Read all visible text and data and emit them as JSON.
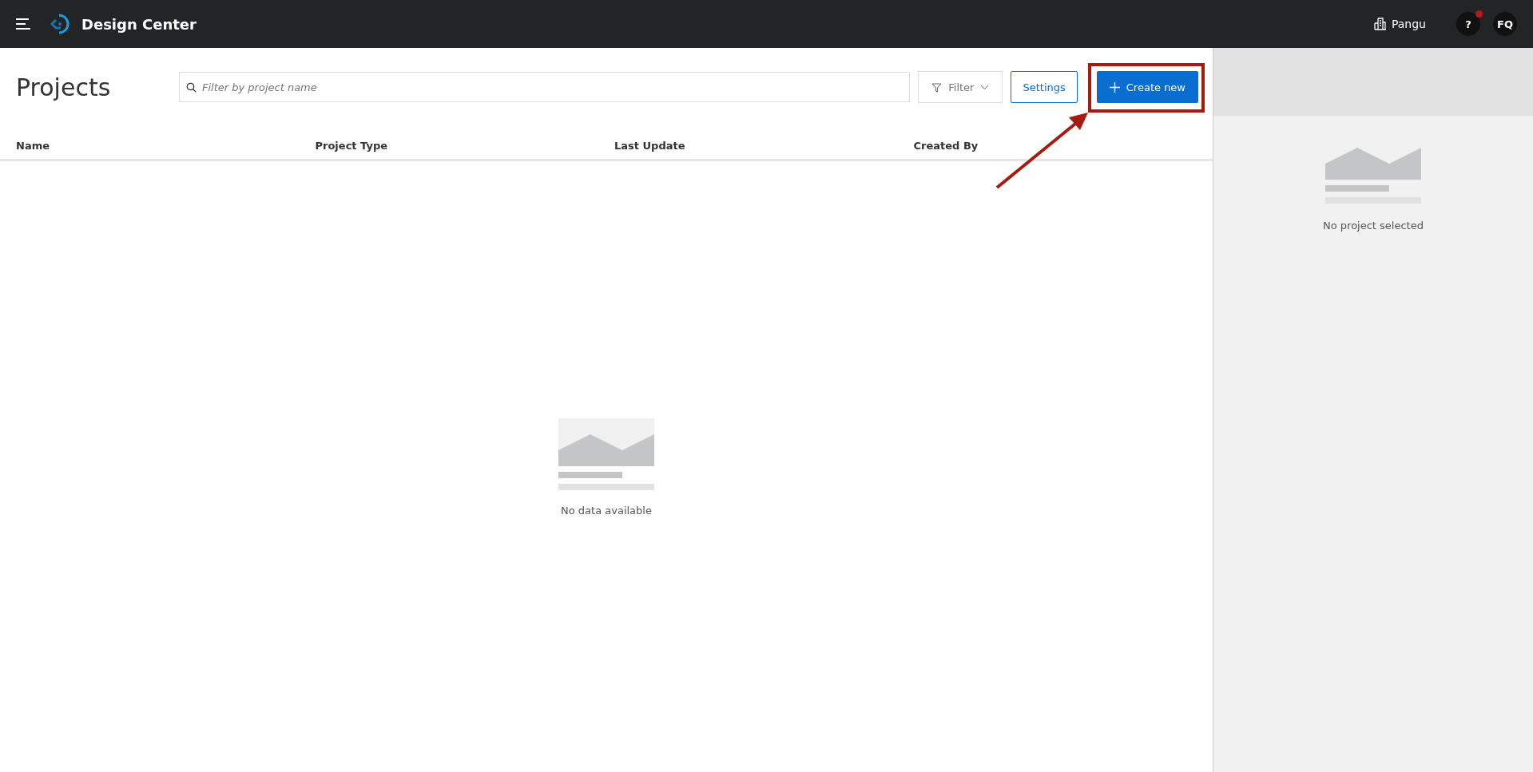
{
  "app_bar": {
    "title": "Design Center",
    "tenant": "Pangu",
    "help_label": "?",
    "help_notification": true,
    "user_initials": "FQ"
  },
  "projects": {
    "title": "Projects",
    "search": {
      "placeholder": "Filter by project name"
    },
    "filter_button": "Filter",
    "settings_button": "Settings",
    "create_button": "Create new",
    "table": {
      "columns": [
        "Name",
        "Project Type",
        "Last Update",
        "Created By"
      ],
      "empty_message": "No data available"
    }
  },
  "detail_panel": {
    "empty_message": "No project selected"
  }
}
